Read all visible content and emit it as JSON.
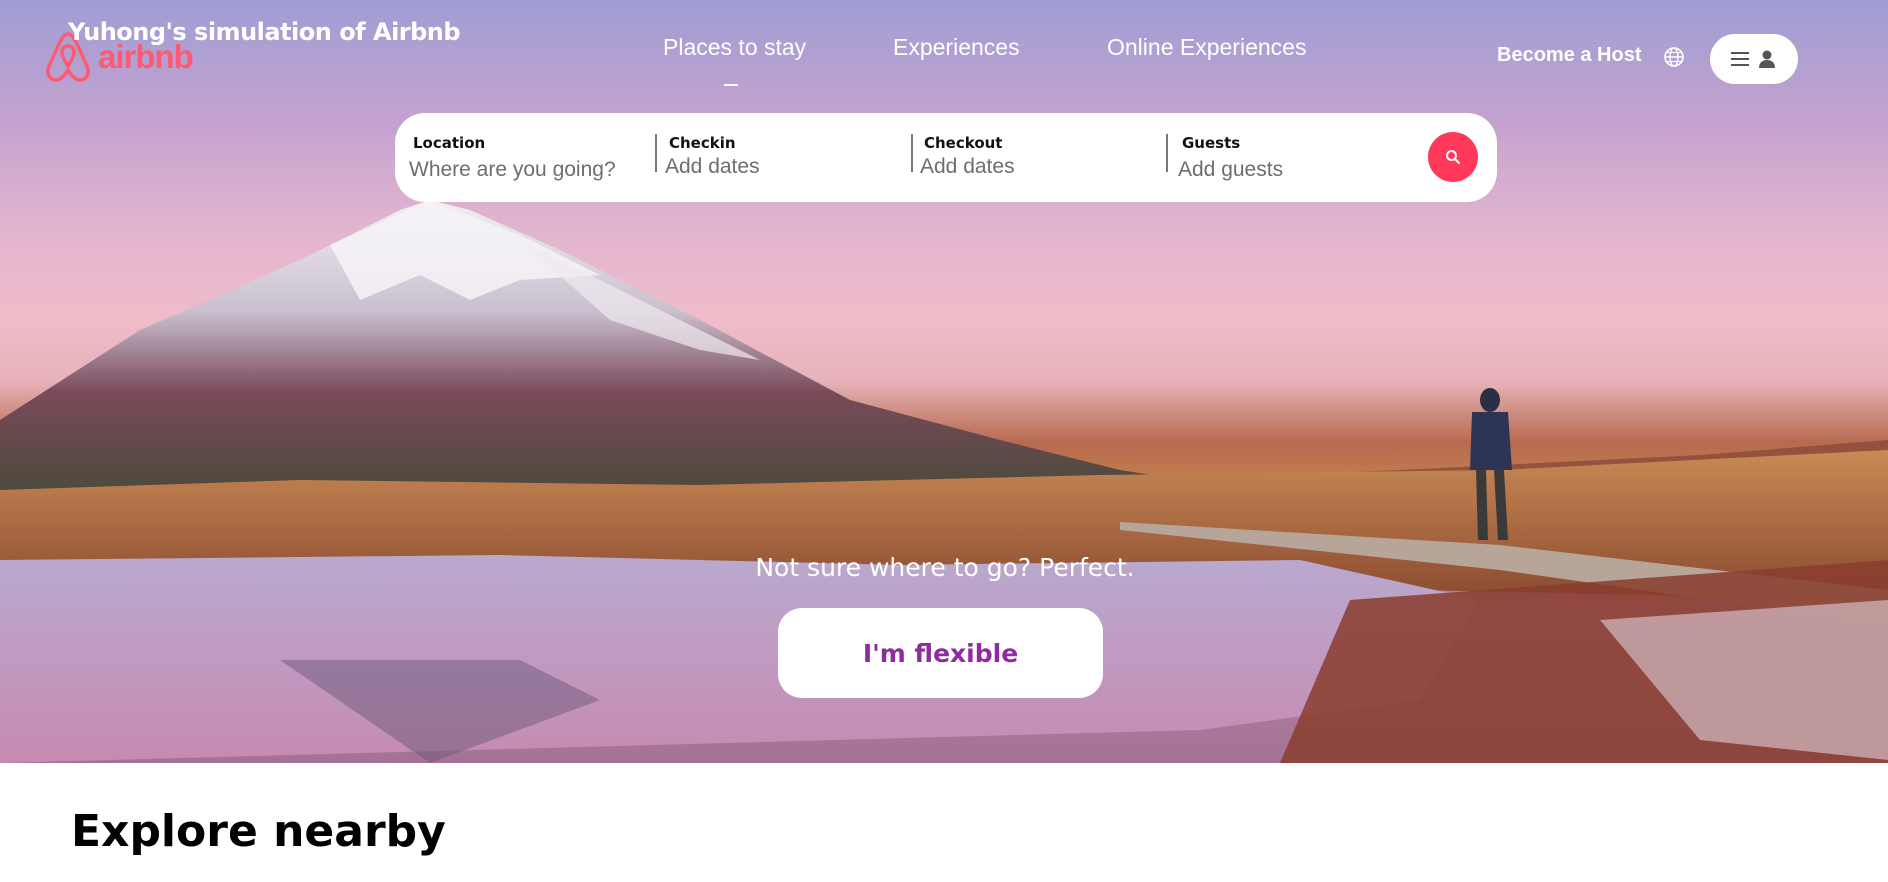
{
  "header": {
    "site_title": "Yuhong's simulation of Airbnb",
    "logo_text": "airbnb",
    "nav_tabs": [
      {
        "label": "Places to stay",
        "active": true
      },
      {
        "label": "Experiences",
        "active": false
      },
      {
        "label": "Online Experiences",
        "active": false
      }
    ],
    "host_label": "Become a Host",
    "icons": {
      "logo": "airbnb-logo-icon",
      "globe": "globe-icon",
      "menu": "menu-icon",
      "user": "user-icon"
    }
  },
  "search": {
    "location_label": "Location",
    "location_placeholder": "Where are you going?",
    "checkin_label": "Checkin",
    "checkin_placeholder": "Add dates",
    "checkout_label": "Checkout",
    "checkout_placeholder": "Add dates",
    "guests_label": "Guests",
    "guests_placeholder": "Add guests",
    "search_icon": "search-icon"
  },
  "hero": {
    "tagline": "Not sure where to go? Perfect.",
    "flexible_button": "I'm flexible"
  },
  "explore": {
    "title": "Explore nearby"
  },
  "colors": {
    "brand": "#ff385c",
    "flexible_text": "#8d2b9f"
  }
}
